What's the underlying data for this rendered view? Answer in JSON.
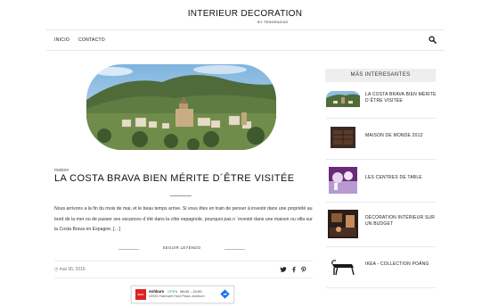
{
  "site": {
    "title": "INTERIEUR DECORATION",
    "subtitle": "BY TENDENZIAS"
  },
  "nav": {
    "items": [
      {
        "label": "INICIO"
      },
      {
        "label": "CONTACTO"
      }
    ]
  },
  "post": {
    "category": "maison",
    "title": "LA COSTA BRAVA BIEN MÉRITE D´ÊTRE VISITÉE",
    "excerpt": "Nous arrivons a la fin du mois de mai, et le beau temps arrive. Si vous êtes en train de penser á investir dans une propriété au bord de la mer ou de passer ses vacances d´été dans la côte espagnole, pourquoi pas n ´investir dans une maison ou villa sur la Costa Brava en Espagne. […]",
    "read_more": "SEGUIR LEYENDO",
    "date": "mai 30, 2016"
  },
  "ad": {
    "logo": "IKEA",
    "name": "Ashburn",
    "status": "OPEN",
    "hours": "08:00 – 22:00",
    "address": "43930 Farmwell Hunt Plaza, Ashburn"
  },
  "sidebar": {
    "heading": "MÁS INTERESANTES",
    "items": [
      {
        "label": "LA COSTA BRAVA BIEN MÉRITE D´ÊTRE VISITÉE"
      },
      {
        "label": "MAISON DE MONDE 2012"
      },
      {
        "label": "LES CENTRES DE TABLE"
      },
      {
        "label": "DÉCORATION INTÉRIEUR SUR UN BUDGET"
      },
      {
        "label": "IKEA - COLLECTION POÄNG"
      }
    ]
  },
  "colors": {
    "accent": "#111111",
    "sidebar_bg": "#eeeeee",
    "ad_open": "#00aa88"
  }
}
